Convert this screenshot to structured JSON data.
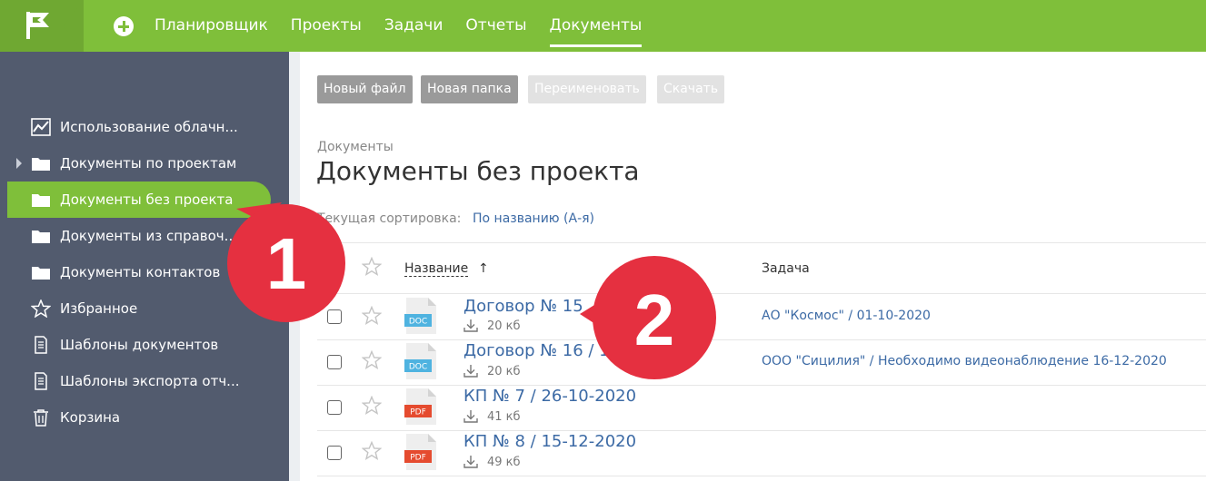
{
  "topbar": {
    "nav": [
      "Планировщик",
      "Проекты",
      "Задачи",
      "Отчеты",
      "Документы"
    ],
    "active_nav": "Документы",
    "accent": "#7fbf3a"
  },
  "sidebar": {
    "items": [
      {
        "label": "Использование облачн...",
        "icon": "chart-icon"
      },
      {
        "label": "Документы по проектам",
        "icon": "folder-icon"
      },
      {
        "label": "Документы без проекта",
        "icon": "folder-icon"
      },
      {
        "label": "Документы из справоч...",
        "icon": "folder-icon"
      },
      {
        "label": "Документы контактов",
        "icon": "folder-icon"
      },
      {
        "label": "Избранное",
        "icon": "star-icon"
      },
      {
        "label": "Шаблоны документов",
        "icon": "document-icon"
      },
      {
        "label": "Шаблоны экспорта отч...",
        "icon": "document-icon"
      },
      {
        "label": "Корзина",
        "icon": "trash-icon"
      }
    ],
    "active_item": "Документы без проекта"
  },
  "toolbar": {
    "new_file": "Новый файл",
    "new_folder": "Новая папка",
    "rename": "Переименовать",
    "download": "Скачать"
  },
  "page": {
    "breadcrumb": "Документы",
    "title": "Документы без проекта",
    "sort_label": "Текущая сортировка:",
    "sort_value": "По названию (А-я)"
  },
  "table": {
    "columns": {
      "name": "Название",
      "task": "Задача"
    },
    "sort_arrow": "↑",
    "rows": [
      {
        "name": "Договор № 15",
        "type": "DOC",
        "size": "20 кб",
        "task": "АО \"Космос\" / 01-10-2020"
      },
      {
        "name": "Договор № 16 / 16-",
        "type": "DOC",
        "size": "20 кб",
        "task": "ООО \"Сицилия\" / Необходимо видеонаблюдение 16-12-2020"
      },
      {
        "name": "КП № 7 / 26-10-2020",
        "type": "PDF",
        "size": "41 кб",
        "task": ""
      },
      {
        "name": "КП № 8 / 15-12-2020",
        "type": "PDF",
        "size": "49 кб",
        "task": ""
      }
    ]
  },
  "callouts": [
    "1",
    "2"
  ]
}
